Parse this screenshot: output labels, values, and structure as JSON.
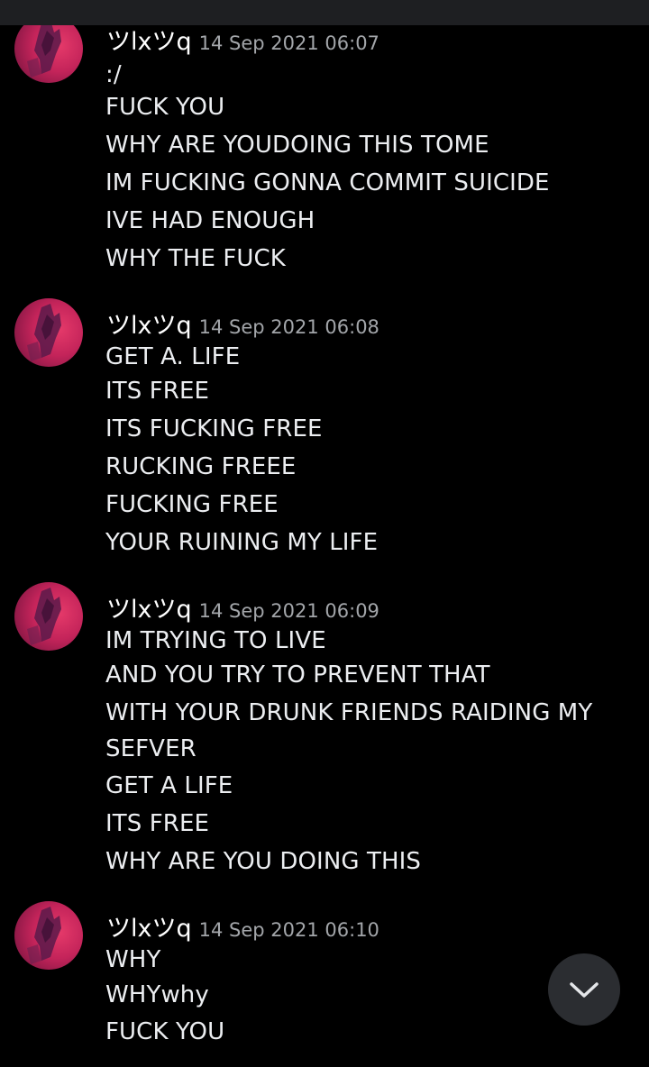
{
  "messages": [
    {
      "username": "ツlxツq",
      "timestamp": "14 Sep 2021 06:07",
      "lines": [
        ":/",
        "FUCK YOU",
        "WHY ARE YOUDOING THIS TOME",
        "IM FUCKING GONNA COMMIT SUICIDE",
        "IVE HAD ENOUGH",
        "WHY THE FUCK"
      ]
    },
    {
      "username": "ツlxツq",
      "timestamp": "14 Sep 2021 06:08",
      "lines": [
        "GET A. LIFE",
        "ITS FREE",
        "ITS FUCKING FREE",
        "RUCKING FREEE",
        "FUCKING FREE",
        "YOUR RUINING MY LIFE"
      ]
    },
    {
      "username": "ツlxツq",
      "timestamp": "14 Sep 2021 06:09",
      "lines": [
        "IM TRYING TO LIVE",
        "AND YOU TRY TO PREVENT THAT",
        "WITH YOUR DRUNK FRIENDS RAIDING MY",
        "SEFVER",
        "GET A LIFE",
        "ITS FREE",
        "WHY ARE YOU DOING THIS"
      ]
    },
    {
      "username": "ツlxツq",
      "timestamp": "14 Sep 2021 06:10",
      "lines": [
        "WHY",
        "WHYwhy",
        "FUCK YOU"
      ]
    }
  ],
  "scroll_button": {
    "icon": "chevron-down-icon"
  },
  "colors": {
    "background": "#000000",
    "username": "#ffffff",
    "timestamp": "#a3a6aa",
    "message_text": "#eceef1",
    "avatar_accent": "#e63a6a",
    "scroll_button_bg": "#2b2d31"
  }
}
